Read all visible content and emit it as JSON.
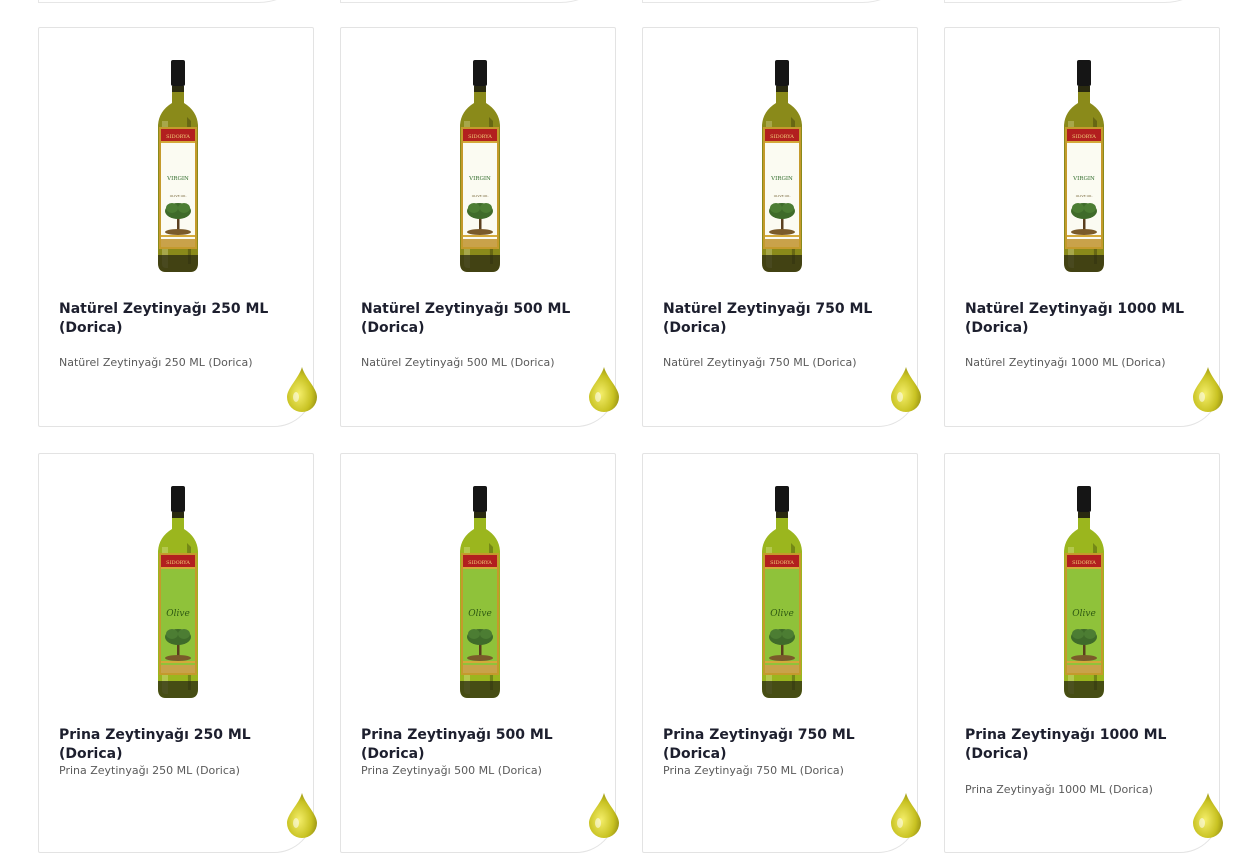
{
  "products": [
    {
      "title": "Natürel Zeytinyağı 250 ML (Dorica)",
      "desc": "Natürel Zeytinyağı 250 ML (Dorica)",
      "label": "VIRGIN",
      "brand": "SIDORYA",
      "variant": "virgin"
    },
    {
      "title": "Natürel Zeytinyağı 500 ML (Dorica)",
      "desc": "Natürel Zeytinyağı 500 ML (Dorica)",
      "label": "VIRGIN",
      "brand": "SIDORYA",
      "variant": "virgin"
    },
    {
      "title": "Natürel Zeytinyağı 750 ML (Dorica)",
      "desc": "Natürel Zeytinyağı 750 ML (Dorica)",
      "label": "VIRGIN",
      "brand": "SIDORYA",
      "variant": "virgin"
    },
    {
      "title": "Natürel Zeytinyağı 1000 ML (Dorica)",
      "desc": "Natürel Zeytinyağı 1000 ML (Dorica)",
      "label": "VIRGIN",
      "brand": "SIDORYA",
      "variant": "virgin"
    },
    {
      "title": "Prina Zeytinyağı 250 ML (Dorica)",
      "desc": "Prina Zeytinyağı 250 ML (Dorica)",
      "label": "Olive",
      "brand": "SIDORYA",
      "variant": "olive"
    },
    {
      "title": "Prina Zeytinyağı 500 ML (Dorica)",
      "desc": "Prina Zeytinyağı 500 ML (Dorica)",
      "label": "Olive",
      "brand": "SIDORYA",
      "variant": "olive"
    },
    {
      "title": "Prina Zeytinyağı 750 ML (Dorica)",
      "desc": "Prina Zeytinyağı 750 ML (Dorica)",
      "label": "Olive",
      "brand": "SIDORYA",
      "variant": "olive"
    },
    {
      "title": "Prina Zeytinyağı 1000 ML (Dorica)",
      "desc": "Prina Zeytinyağı 1000 ML (Dorica)",
      "label": "Olive",
      "brand": "SIDORYA",
      "variant": "olive"
    }
  ],
  "colors": {
    "title": "#1d1f2e",
    "desc": "#5a5a5a",
    "border": "#e3e3e3",
    "drop": "#c8c222",
    "oil_virgin": "#8a8a1a",
    "oil_olive": "#9bb61e"
  },
  "icons": {
    "drop": "olive-oil-drop-icon"
  }
}
